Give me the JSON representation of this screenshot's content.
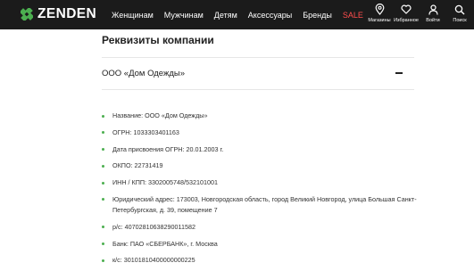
{
  "header": {
    "logo": "ZENDEN",
    "nav": [
      "Женщинам",
      "Мужчинам",
      "Детям",
      "Аксессуары",
      "Бренды",
      "SALE"
    ],
    "actions": [
      {
        "label": "Магазины",
        "icon": "map-pin-icon"
      },
      {
        "label": "Избранное",
        "icon": "heart-icon"
      },
      {
        "label": "Войти",
        "icon": "user-icon"
      },
      {
        "label": "Поиск",
        "icon": "search-icon"
      }
    ]
  },
  "page": {
    "title": "Реквизиты компании",
    "section": {
      "title": "ООО «Дом Одежды»",
      "toggle": "collapse",
      "items": [
        "Название: ООО «Дом Одежды»",
        "ОГРН: 1033303401163",
        "Дата присвоения ОГРН: 20.01.2003 г.",
        "ОКПО: 22731419",
        "ИНН / КПП: 3302005748/532101001",
        "Юридический адрес: 173003, Новгородская область, город Великий Новгород, улица Большая Санкт-Петербургская, д. 39, помещение 7",
        "р/с: 40702810638290011582",
        "Банк: ПАО «СБЕРБАНК», г. Москва",
        "к/с: 30101810400000000225"
      ]
    }
  },
  "colors": {
    "header_bg": "#1b1b1b",
    "accent_green": "#4caf50",
    "sale_red": "#ff4d4d"
  }
}
